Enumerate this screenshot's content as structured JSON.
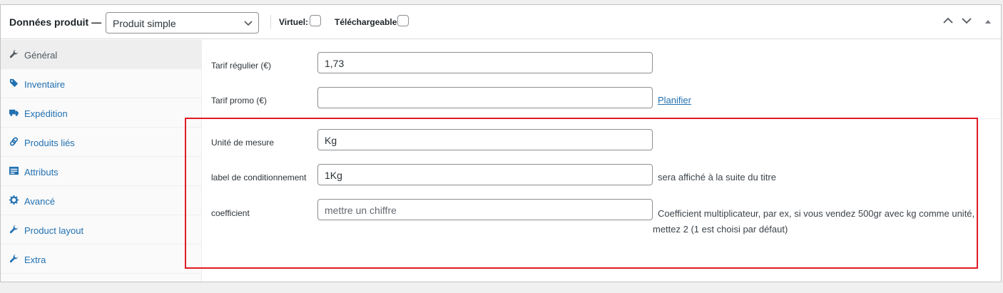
{
  "header": {
    "title": "Données produit —",
    "product_type": "Produit simple",
    "virtual_label": "Virtuel:",
    "download_label": "Téléchargeable:"
  },
  "sidebar": {
    "items": [
      {
        "label": "Général",
        "icon": "wrench-icon",
        "active": true
      },
      {
        "label": "Inventaire",
        "icon": "tag-icon"
      },
      {
        "label": "Expédition",
        "icon": "truck-icon"
      },
      {
        "label": "Produits liés",
        "icon": "link-icon"
      },
      {
        "label": "Attributs",
        "icon": "list-icon"
      },
      {
        "label": "Avancé",
        "icon": "gear-icon"
      },
      {
        "label": "Product layout",
        "icon": "wrench-icon"
      },
      {
        "label": "Extra",
        "icon": "wrench-icon"
      }
    ]
  },
  "fields": {
    "regular_price": {
      "label": "Tarif régulier (€)",
      "value": "1,73"
    },
    "sale_price": {
      "label": "Tarif promo (€)",
      "value": "",
      "link": "Planifier"
    },
    "unit": {
      "label": "Unité de mesure",
      "value": "Kg"
    },
    "packaging": {
      "label": "label de conditionnement",
      "value": "1Kg",
      "description": "sera affiché à la suite du titre"
    },
    "coefficient": {
      "label": "coefficient",
      "placeholder": "mettre un chiffre",
      "description_line1": "Coefficient multiplicateur, par ex, si vous vendez 500gr avec kg comme unité,",
      "description_line2": "mettez 2 (1 est choisi par défaut)"
    }
  },
  "colors": {
    "link": "#2271b1",
    "highlight": "#e01b24"
  }
}
